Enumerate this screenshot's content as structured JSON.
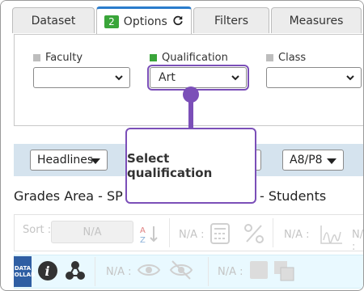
{
  "tabs": [
    {
      "label": "Dataset"
    },
    {
      "label": "Options",
      "badge": "2"
    },
    {
      "label": "Filters"
    },
    {
      "label": "Measures"
    }
  ],
  "fields": [
    {
      "label": "Faculty",
      "value": "",
      "color": "#bdbdbd"
    },
    {
      "label": "Qualification",
      "value": "Art",
      "color": "#3aa53a"
    },
    {
      "label": "Class",
      "value": "",
      "color": "#bdbdbd"
    }
  ],
  "toolbar": {
    "headlines_label": "Headlines",
    "metric_label": "A8/P8"
  },
  "section": {
    "title_left": "Grades Area - SP",
    "title_right": "- Students"
  },
  "row1": {
    "sort_label": "Sort :",
    "sort_value": "N/A",
    "na1": "N/A :",
    "na2": "N/A :",
    "na3": "N/A :"
  },
  "row2": {
    "data_collab_line1": "DATA",
    "data_collab_line2": "COLLAB",
    "na1": "N/A :",
    "na2": "N/A :"
  },
  "callout": {
    "text": "Select qualification"
  },
  "colors": {
    "accent": "#7b4fb8",
    "active_tab": "#2a7ccc",
    "band": "#d5e3ee"
  }
}
